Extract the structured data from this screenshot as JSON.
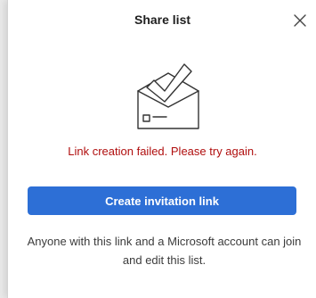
{
  "dialog": {
    "title": "Share list",
    "illustration_icon": "envelope-check-icon",
    "close_icon": "close-icon",
    "error_message": "Link creation failed. Please try again.",
    "create_button_label": "Create invitation link",
    "info_text": "Anyone with this link and a Microsoft account can join and edit this list."
  },
  "colors": {
    "accent": "#2d6fd6",
    "error": "#b00e0e",
    "text_primary": "#1f1f1f",
    "text_secondary": "#3b3b3b",
    "illustration_stroke": "#333333"
  }
}
